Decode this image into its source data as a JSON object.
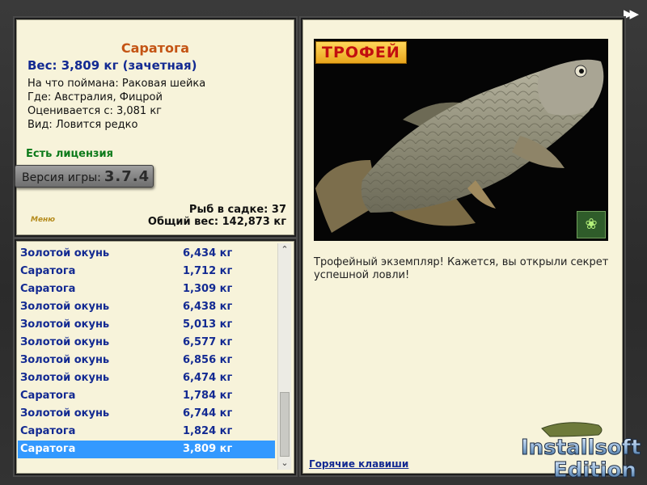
{
  "catch": {
    "fish_name": "Саратога",
    "weight_text": "Вес: 3,809 кг (зачетная)",
    "caught_on": "На что поймана: Раковая шейка",
    "location": "Где: Австралия, Фицрой",
    "valued_from": "Оценивается с: 3,081 кг",
    "rarity": "Вид: Ловится редко",
    "license": "Есть лицензия",
    "version_label": "Версия игры:",
    "version_number": "3.7.4",
    "menu_label": "Меню",
    "fish_in_net": "Рыб в садке: 37",
    "total_weight": "Общий вес: 142,873 кг"
  },
  "catch_list": [
    {
      "name": "Золотой окунь",
      "weight": "6,434 кг"
    },
    {
      "name": "Саратога",
      "weight": "1,712 кг"
    },
    {
      "name": "Саратога",
      "weight": "1,309 кг"
    },
    {
      "name": "Золотой окунь",
      "weight": "6,438 кг"
    },
    {
      "name": "Золотой окунь",
      "weight": "5,013 кг"
    },
    {
      "name": "Золотой окунь",
      "weight": "6,577 кг"
    },
    {
      "name": "Золотой окунь",
      "weight": "6,856 кг"
    },
    {
      "name": "Золотой окунь",
      "weight": "6,474 кг"
    },
    {
      "name": "Саратога",
      "weight": "1,784 кг"
    },
    {
      "name": "Золотой окунь",
      "weight": "6,744 кг"
    },
    {
      "name": "Саратога",
      "weight": "1,824 кг"
    },
    {
      "name": "Саратога",
      "weight": "3,809 кг"
    }
  ],
  "selected_index": 11,
  "detail": {
    "trophy_badge": "ТРОФЕЙ",
    "message": "Трофейный экземпляр! Кажется, вы открыли секрет успешной ловли!",
    "hotkeys_link": "Горячие клавиши"
  },
  "watermark": {
    "line1": "Installsoft",
    "line2": "Edition"
  },
  "colors": {
    "fish_name": "#c45414",
    "weight": "#132a92",
    "license": "#0d7a1a",
    "selected_row": "#3399ff",
    "panel_bg": "#f7f3da"
  },
  "icons": {
    "fast_forward": "fast-forward-icon",
    "butterfly": "butterfly-icon",
    "scroll_up": "chevron-up-icon",
    "scroll_down": "chevron-down-icon"
  }
}
